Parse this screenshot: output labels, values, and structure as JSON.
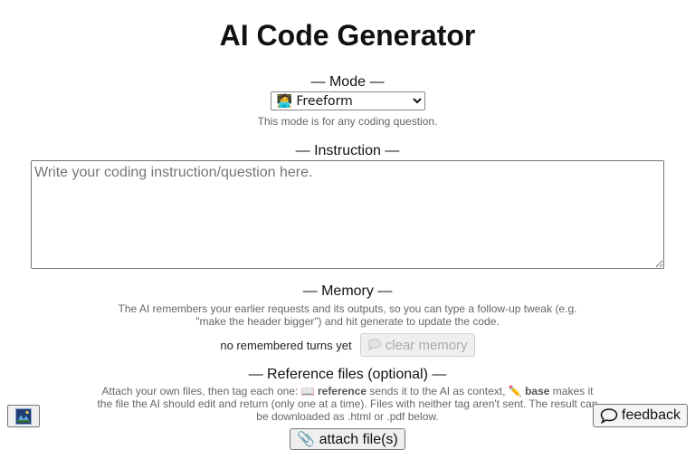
{
  "header": {
    "title": "AI Code Generator"
  },
  "mode": {
    "label": "— Mode —",
    "selected_option": "🧑‍💻 Freeform",
    "description": "This mode is for any coding question."
  },
  "instruction": {
    "label": "— Instruction —",
    "placeholder": "Write your coding instruction/question here.",
    "value": ""
  },
  "memory": {
    "label": "— Memory —",
    "description": "The AI remembers your earlier requests and its outputs, so you can type a follow-up tweak (e.g. \"make the header bigger\") and hit generate to update the code.",
    "status": "no remembered turns yet",
    "clear_button": "clear memory",
    "clear_icon": "speech-bubble-icon"
  },
  "reference_files": {
    "label": "— Reference files (optional) —",
    "desc_part1": "Attach your own files, then tag each one: ",
    "reference_icon": "📖",
    "reference_word": "reference",
    "desc_part2": " sends it to the AI as context, ",
    "base_icon": "✏️",
    "base_word": "base",
    "desc_part3": " makes it the file the AI should edit and return (only one at a time). Files with neither tag aren't sent. The result can be downloaded as .html or .pdf below.",
    "attach_icon": "📎",
    "attach_button": "attach file(s)"
  },
  "corner_button": {
    "icon": "landscape-picture-icon"
  },
  "feedback": {
    "label": "feedback",
    "icon": "speech-bubble-icon"
  },
  "colors": {
    "muted_text": "#666666",
    "disabled_text": "#aaaaaa",
    "button_bg": "#efefef",
    "border": "#767676"
  }
}
